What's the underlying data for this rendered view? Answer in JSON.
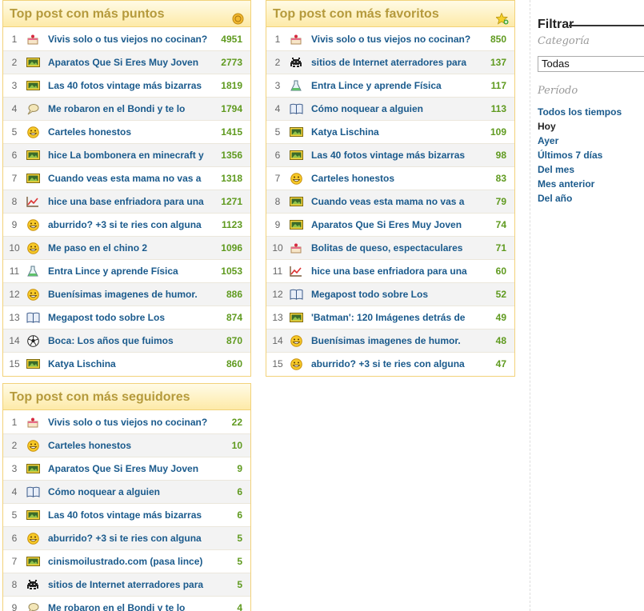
{
  "boxes": [
    {
      "title": "Top post con más puntos",
      "header_icon": "coin-icon",
      "rows": [
        {
          "n": "1",
          "icon": "cake-icon",
          "title": "Vivis solo o tus viejos no cocinan?",
          "value": "4951"
        },
        {
          "n": "2",
          "icon": "image-icon",
          "title": "Aparatos Que Si Eres Muy Joven",
          "value": "2773"
        },
        {
          "n": "3",
          "icon": "image-icon",
          "title": "Las 40 fotos vintage más bizarras",
          "value": "1819"
        },
        {
          "n": "4",
          "icon": "speech-icon",
          "title": "Me robaron en el Bondi y te lo",
          "value": "1794"
        },
        {
          "n": "5",
          "icon": "smiley-icon",
          "title": "Carteles honestos",
          "value": "1415"
        },
        {
          "n": "6",
          "icon": "image-icon",
          "title": "hice La bombonera en minecraft y",
          "value": "1356"
        },
        {
          "n": "7",
          "icon": "image-icon",
          "title": "Cuando veas esta mama no vas a",
          "value": "1318"
        },
        {
          "n": "8",
          "icon": "chart-icon",
          "title": "hice una base enfriadora para una",
          "value": "1271"
        },
        {
          "n": "9",
          "icon": "smiley-icon",
          "title": "aburrido? +3 si te ries con alguna",
          "value": "1123"
        },
        {
          "n": "10",
          "icon": "smiley-icon",
          "title": "Me paso en el chino 2",
          "value": "1096"
        },
        {
          "n": "11",
          "icon": "flask-icon",
          "title": "Entra Lince y aprende Física",
          "value": "1053"
        },
        {
          "n": "12",
          "icon": "smiley-icon",
          "title": "Buenísimas imagenes de humor.",
          "value": "886"
        },
        {
          "n": "13",
          "icon": "book-icon",
          "title": "Megapost todo sobre Los",
          "value": "874"
        },
        {
          "n": "14",
          "icon": "ball-icon",
          "title": "Boca: Los años que fuimos",
          "value": "870"
        },
        {
          "n": "15",
          "icon": "image-icon",
          "title": "Katya Lischina",
          "value": "860"
        }
      ]
    },
    {
      "title": "Top post con más favoritos",
      "header_icon": "star-icon",
      "rows": [
        {
          "n": "1",
          "icon": "cake-icon",
          "title": "Vivis solo o tus viejos no cocinan?",
          "value": "850"
        },
        {
          "n": "2",
          "icon": "invader-icon",
          "title": "sitios de Internet aterradores para",
          "value": "137"
        },
        {
          "n": "3",
          "icon": "flask-icon",
          "title": "Entra Lince y aprende Física",
          "value": "117"
        },
        {
          "n": "4",
          "icon": "book-icon",
          "title": "Cómo noquear a alguien",
          "value": "113"
        },
        {
          "n": "5",
          "icon": "image-icon",
          "title": "Katya Lischina",
          "value": "109"
        },
        {
          "n": "6",
          "icon": "image-icon",
          "title": "Las 40 fotos vintage más bizarras",
          "value": "98"
        },
        {
          "n": "7",
          "icon": "smiley-icon",
          "title": "Carteles honestos",
          "value": "83"
        },
        {
          "n": "8",
          "icon": "image-icon",
          "title": "Cuando veas esta mama no vas a",
          "value": "79"
        },
        {
          "n": "9",
          "icon": "image-icon",
          "title": "Aparatos Que Si Eres Muy Joven",
          "value": "74"
        },
        {
          "n": "10",
          "icon": "cake-icon",
          "title": "Bolitas de queso, espectaculares",
          "value": "71"
        },
        {
          "n": "11",
          "icon": "chart-icon",
          "title": "hice una base enfriadora para una",
          "value": "60"
        },
        {
          "n": "12",
          "icon": "book-icon",
          "title": "Megapost todo sobre Los",
          "value": "52"
        },
        {
          "n": "13",
          "icon": "image-icon",
          "title": "'Batman': 120 Imágenes detrás de",
          "value": "49"
        },
        {
          "n": "14",
          "icon": "smiley-icon",
          "title": "Buenísimas imagenes de humor.",
          "value": "48"
        },
        {
          "n": "15",
          "icon": "smiley-icon",
          "title": "aburrido? +3 si te ries con alguna",
          "value": "47"
        }
      ]
    },
    {
      "title": "Top post con más seguidores",
      "header_icon": "",
      "rows": [
        {
          "n": "1",
          "icon": "cake-icon",
          "title": "Vivis solo o tus viejos no cocinan?",
          "value": "22"
        },
        {
          "n": "2",
          "icon": "smiley-icon",
          "title": "Carteles honestos",
          "value": "10"
        },
        {
          "n": "3",
          "icon": "image-icon",
          "title": "Aparatos Que Si Eres Muy Joven",
          "value": "9"
        },
        {
          "n": "4",
          "icon": "book-icon",
          "title": "Cómo noquear a alguien",
          "value": "6"
        },
        {
          "n": "5",
          "icon": "image-icon",
          "title": "Las 40 fotos vintage más bizarras",
          "value": "6"
        },
        {
          "n": "6",
          "icon": "smiley-icon",
          "title": "aburrido? +3 si te ries con alguna",
          "value": "5"
        },
        {
          "n": "7",
          "icon": "image-icon",
          "title": "cinismoilustrado.com (pasa lince)",
          "value": "5"
        },
        {
          "n": "8",
          "icon": "invader-icon",
          "title": "sitios de Internet aterradores para",
          "value": "5"
        },
        {
          "n": "9",
          "icon": "speech-icon",
          "title": "Me robaron en el Bondi y te lo",
          "value": "4"
        }
      ]
    }
  ],
  "filter": {
    "title": "Filtrar",
    "category_label": "Categoría",
    "category_value": "Todas",
    "period_label": "Período",
    "periods": [
      "Todos los tiempos",
      "Hoy",
      "Ayer",
      "Últimos 7 días",
      "Del mes",
      "Mes anterior",
      "Del año"
    ],
    "active_period": "Hoy"
  },
  "colors": {
    "value": "#5f9a1f",
    "link": "#1a5a8c",
    "header_text": "#b59a3c",
    "border": "#f2d27a"
  }
}
